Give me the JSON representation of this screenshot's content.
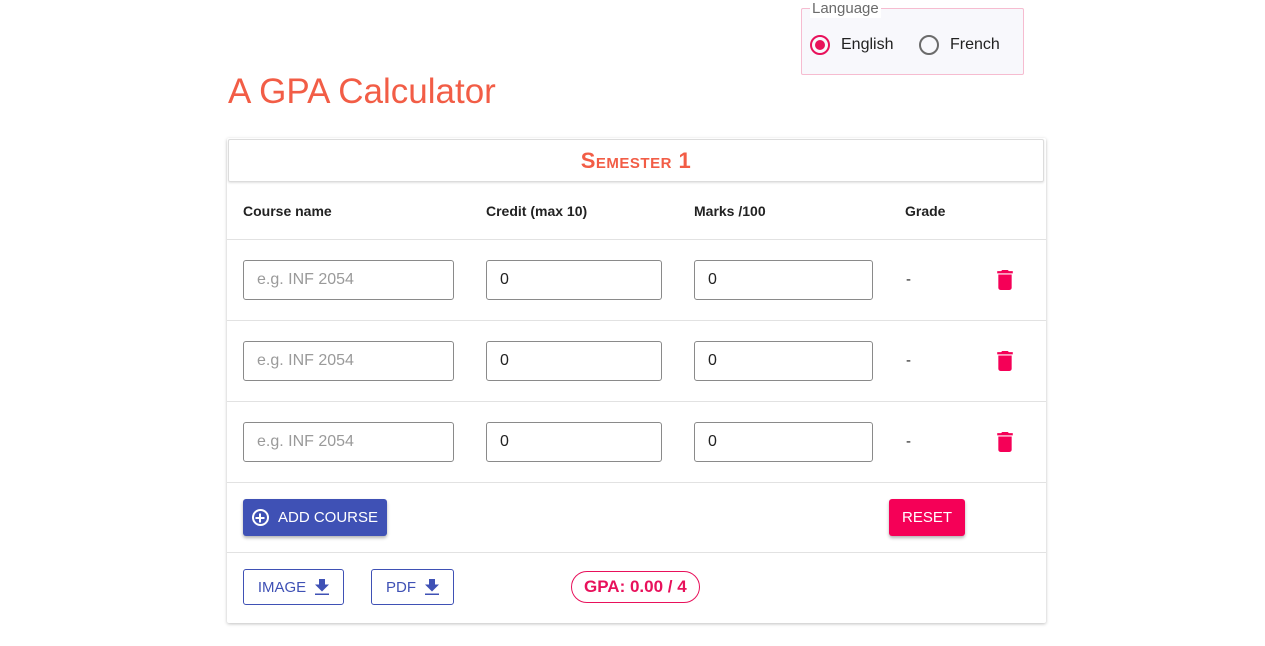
{
  "language": {
    "legend": "Language",
    "options": [
      {
        "label": "English",
        "checked": true
      },
      {
        "label": "French",
        "checked": false
      }
    ]
  },
  "title": "A GPA Calculator",
  "semester": {
    "title": "Semester 1",
    "columns": [
      "Course name",
      "Credit (max 10)",
      "Marks /100",
      "Grade"
    ],
    "rows": [
      {
        "course_placeholder": "e.g. INF 2054",
        "course": "",
        "credit": "0",
        "marks": "0",
        "grade": "-"
      },
      {
        "course_placeholder": "e.g. INF 2054",
        "course": "",
        "credit": "0",
        "marks": "0",
        "grade": "-"
      },
      {
        "course_placeholder": "e.g. INF 2054",
        "course": "",
        "credit": "0",
        "marks": "0",
        "grade": "-"
      }
    ],
    "add_course_label": "ADD COURSE",
    "reset_label": "RESET",
    "image_label": "IMAGE",
    "pdf_label": "PDF",
    "gpa_text": "GPA: 0.00 / 4"
  },
  "colors": {
    "accent": "#f25d46",
    "primary": "#3f51b5",
    "secondary": "#f50057"
  },
  "icons": {
    "delete": "trash-icon",
    "add": "plus-circle-icon",
    "download": "download-icon"
  }
}
